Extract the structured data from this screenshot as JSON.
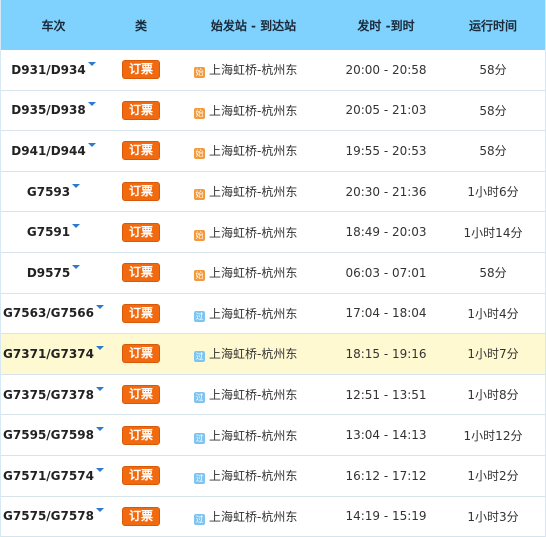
{
  "header": {
    "train_no": "车次",
    "type": "类",
    "route": "始发站 - 到达站",
    "times": "发时 -到时",
    "duration": "运行时间"
  },
  "book_label": "订票",
  "rows": [
    {
      "train": "D931/D934",
      "badge": "始",
      "route": "上海虹桥-杭州东",
      "times": "20:00 - 20:58",
      "duration": "58分"
    },
    {
      "train": "D935/D938",
      "badge": "始",
      "route": "上海虹桥-杭州东",
      "times": "20:05 - 21:03",
      "duration": "58分"
    },
    {
      "train": "D941/D944",
      "badge": "始",
      "route": "上海虹桥-杭州东",
      "times": "19:55 - 20:53",
      "duration": "58分"
    },
    {
      "train": "G7593",
      "badge": "始",
      "route": "上海虹桥-杭州东",
      "times": "20:30 - 21:36",
      "duration": "1小时6分"
    },
    {
      "train": "G7591",
      "badge": "始",
      "route": "上海虹桥-杭州东",
      "times": "18:49 - 20:03",
      "duration": "1小时14分"
    },
    {
      "train": "D9575",
      "badge": "始",
      "route": "上海虹桥-杭州东",
      "times": "06:03 - 07:01",
      "duration": "58分"
    },
    {
      "train": "G7563/G7566",
      "badge": "过",
      "route": "上海虹桥-杭州东",
      "times": "17:04 - 18:04",
      "duration": "1小时4分"
    },
    {
      "train": "G7371/G7374",
      "badge": "过",
      "route": "上海虹桥-杭州东",
      "times": "18:15 - 19:16",
      "duration": "1小时7分"
    },
    {
      "train": "G7375/G7378",
      "badge": "过",
      "route": "上海虹桥-杭州东",
      "times": "12:51 - 13:51",
      "duration": "1小时8分"
    },
    {
      "train": "G7595/G7598",
      "badge": "过",
      "route": "上海虹桥-杭州东",
      "times": "13:04 - 14:13",
      "duration": "1小时12分"
    },
    {
      "train": "G7571/G7574",
      "badge": "过",
      "route": "上海虹桥-杭州东",
      "times": "16:12 - 17:12",
      "duration": "1小时2分"
    },
    {
      "train": "G7575/G7578",
      "badge": "过",
      "route": "上海虹桥-杭州东",
      "times": "14:19 - 15:19",
      "duration": "1小时3分"
    }
  ],
  "highlight_index": 7,
  "colors": {
    "header_bg": "#7fd2fd",
    "book_bg": "#f26a10",
    "highlight_bg": "#fff9d2",
    "start_badge": "#f29a3c",
    "pass_badge": "#7fc4ee"
  }
}
